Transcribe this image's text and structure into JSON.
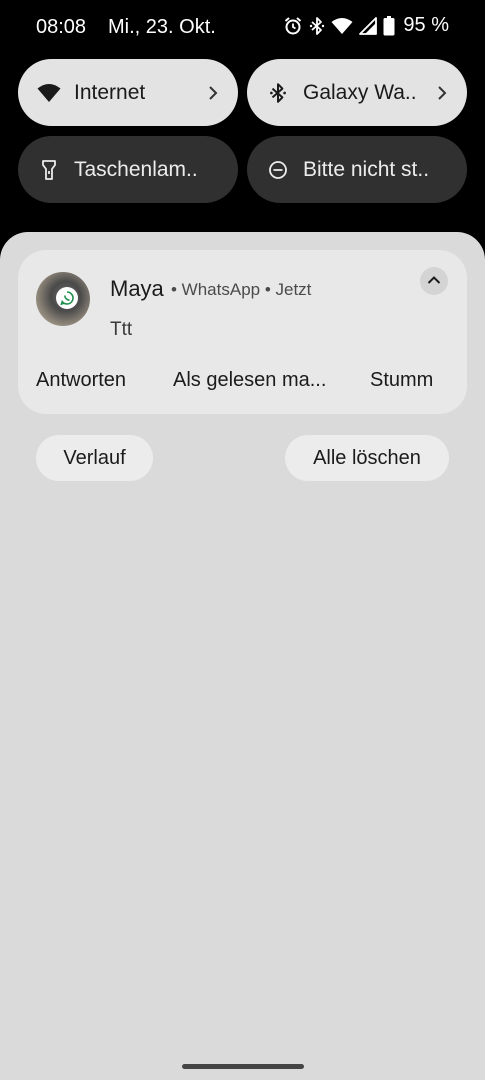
{
  "status_bar": {
    "time": "08:08",
    "date": "Mi., 23. Okt.",
    "icons": [
      "alarm-icon",
      "bluetooth-icon",
      "wifi-icon",
      "signal-icon",
      "battery-icon"
    ],
    "battery_percent": "95 %"
  },
  "quick_tiles": [
    {
      "label": "Internet",
      "icon": "wifi-icon",
      "state": "on",
      "has_chevron": true
    },
    {
      "label": "Galaxy Wa..",
      "icon": "bluetooth-icon",
      "state": "on",
      "has_chevron": true
    },
    {
      "label": "Taschenlam..",
      "icon": "flashlight-icon",
      "state": "off",
      "has_chevron": false
    },
    {
      "label": "Bitte nicht st..",
      "icon": "do-not-disturb-icon",
      "state": "off",
      "has_chevron": false
    }
  ],
  "notification": {
    "sender": "Maya",
    "meta": "• WhatsApp • Jetzt",
    "message": "Ttt",
    "app_badge_icon": "whatsapp-icon",
    "badge_color": "#1f8f4e",
    "actions": [
      "Antworten",
      "Als gelesen ma...",
      "Stumm"
    ]
  },
  "buttons": {
    "history": "Verlauf",
    "clear_all": "Alle löschen"
  },
  "colors": {
    "tile_on": "#e3e3e3",
    "tile_off": "#303030",
    "shade": "#dadada",
    "card": "#e8e8e8"
  }
}
